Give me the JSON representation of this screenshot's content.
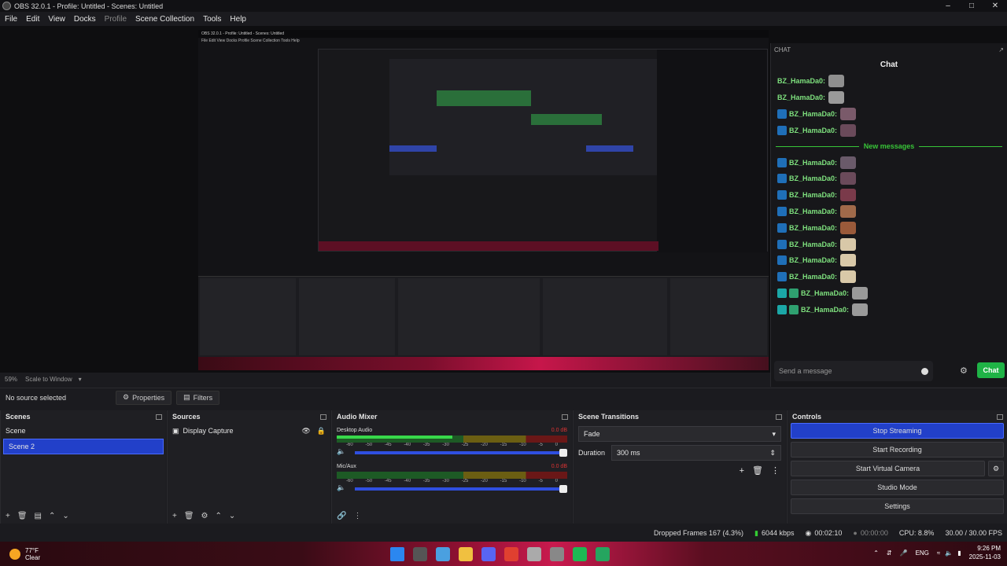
{
  "window": {
    "title": "OBS 32.0.1 - Profile: Untitled - Scenes: Untitled"
  },
  "menu": {
    "items": [
      "File",
      "Edit",
      "View",
      "Docks",
      "Profile",
      "Scene Collection",
      "Tools",
      "Help"
    ]
  },
  "preview": {
    "inner_title": "OBS 32.0.1 - Profile: Untitled - Scenes: Untitled",
    "inner_menu": "File  Edit  View  Docks  Profile  Scene Collection  Tools  Help"
  },
  "chat": {
    "header": "CHAT",
    "title": "Chat",
    "messages": [
      {
        "user": "BZ_HamaDa0:",
        "badge": "none",
        "emote": "#8f8f8f"
      },
      {
        "user": "BZ_HamaDa0:",
        "badge": "none",
        "emote": "#9a9a9a"
      },
      {
        "user": "BZ_HamaDa0:",
        "badge": "prime",
        "emote": "#7a5a6a"
      },
      {
        "user": "BZ_HamaDa0:",
        "badge": "prime",
        "emote": "#6a4a5a"
      },
      {
        "user": "BZ_HamaDa0:",
        "badge": "prime",
        "emote": "#6a5a6a"
      },
      {
        "user": "BZ_HamaDa0:",
        "badge": "prime",
        "emote": "#6a4a5a"
      },
      {
        "user": "BZ_HamaDa0:",
        "badge": "prime",
        "emote": "#7a3a4a"
      },
      {
        "user": "BZ_HamaDa0:",
        "badge": "prime",
        "emote": "#a06a4a"
      },
      {
        "user": "BZ_HamaDa0:",
        "badge": "prime",
        "emote": "#9a5a3a"
      },
      {
        "user": "BZ_HamaDa0:",
        "badge": "prime",
        "emote": "#d8c8a8"
      },
      {
        "user": "BZ_HamaDa0:",
        "badge": "prime",
        "emote": "#d8c8a8"
      },
      {
        "user": "BZ_HamaDa0:",
        "badge": "prime",
        "emote": "#d8c8a8"
      },
      {
        "user": "BZ_HamaDa0:",
        "badge": "sub",
        "emote": "#9a9a9a"
      },
      {
        "user": "BZ_HamaDa0:",
        "badge": "sub",
        "emote": "#9a9a9a"
      }
    ],
    "new_messages": "New messages",
    "input_placeholder": "Send a message",
    "send_label": "Chat"
  },
  "zoom": {
    "value": "59%",
    "mode": "Scale to Window"
  },
  "properties_bar": {
    "no_source": "No source selected",
    "properties": "Properties",
    "filters": "Filters"
  },
  "scenes": {
    "title": "Scenes",
    "items": [
      "Scene",
      "Scene 2"
    ],
    "selected": 1
  },
  "sources": {
    "title": "Sources",
    "items": [
      "Display Capture"
    ]
  },
  "mixer": {
    "title": "Audio Mixer",
    "channels": [
      {
        "name": "Desktop Audio",
        "db": "0.0 dB",
        "level": 0.5
      },
      {
        "name": "Mic/Aux",
        "db": "0.0 dB",
        "level": 0.0
      }
    ],
    "ticks": [
      "-60",
      "-50",
      "-45",
      "-40",
      "-35",
      "-30",
      "-25",
      "-20",
      "-15",
      "-10",
      "-5",
      "0"
    ]
  },
  "transitions": {
    "title": "Scene Transitions",
    "type": "Fade",
    "duration_label": "Duration",
    "duration_value": "300 ms"
  },
  "controls": {
    "title": "Controls",
    "buttons": [
      "Stop Streaming",
      "Start Recording",
      "Start Virtual Camera",
      "Studio Mode",
      "Settings"
    ]
  },
  "status": {
    "dropped": "Dropped Frames 167 (4.3%)",
    "bitrate": "6044 kbps",
    "stream_time": "00:02:10",
    "rec_time": "00:00:00",
    "cpu": "CPU: 8.8%",
    "fps": "30.00 / 30.00 FPS"
  },
  "taskbar": {
    "weather_temp": "77°F",
    "weather_desc": "Clear",
    "lang": "ENG",
    "time": "9:26 PM",
    "date": "2025-11-03",
    "icon_colors": [
      "#2b87f0",
      "#555",
      "#4aa0e0",
      "#f0c040",
      "#5865f2",
      "#e04030",
      "#aaa",
      "#888",
      "#1db954",
      "#25a55f"
    ]
  }
}
